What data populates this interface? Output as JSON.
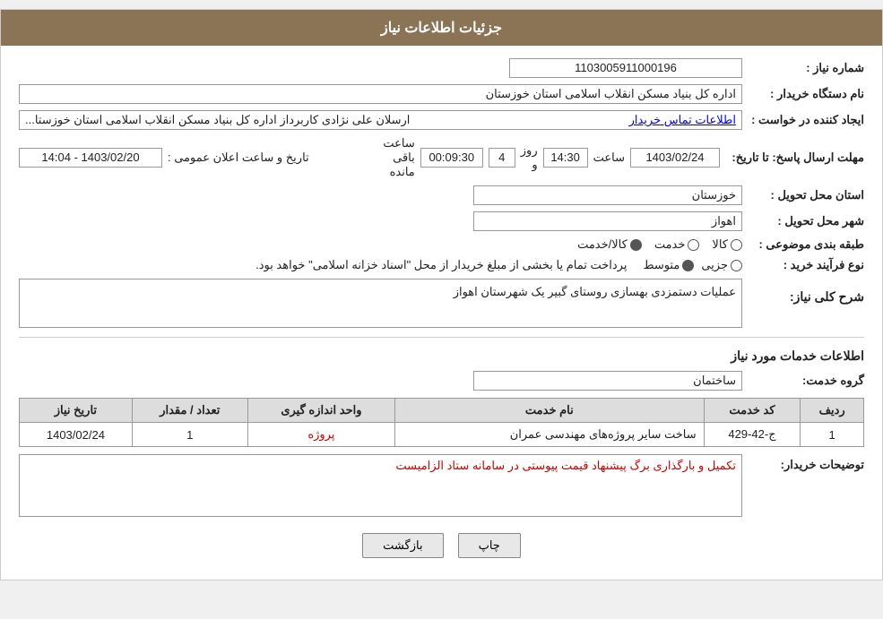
{
  "header": {
    "title": "جزئیات اطلاعات نیاز"
  },
  "fields": {
    "need_number_label": "شماره نیاز :",
    "need_number_value": "1103005911000196",
    "buyer_org_label": "نام دستگاه خریدار :",
    "buyer_org_value": "اداره کل بنیاد مسکن انقلاب اسلامی استان خوزستان",
    "creator_label": "ایجاد کننده در خواست :",
    "creator_value": "ارسلان علی نژادی کاربرداز اداره کل بنیاد مسکن انقلاب اسلامی استان خوزستا...",
    "creator_link": "اطلاعات تماس خریدار",
    "response_date_label": "مهلت ارسال پاسخ: تا تاریخ:",
    "announcement_label": "تاریخ و ساعت اعلان عمومی :",
    "announcement_value": "1403/02/20 - 14:04",
    "response_date": "1403/02/24",
    "response_time_label": "ساعت",
    "response_time": "14:30",
    "response_days_label": "روز و",
    "response_days": "4",
    "response_remaining_label": "ساعت باقی مانده",
    "response_remaining": "00:09:30",
    "province_label": "استان محل تحویل :",
    "province_value": "خوزستان",
    "city_label": "شهر محل تحویل :",
    "city_value": "اهواز",
    "category_label": "طبقه بندی موضوعی :",
    "category_goods": "کالا",
    "category_service": "خدمت",
    "category_goods_service": "کالا/خدمت",
    "category_selected": "goods_service",
    "purchase_type_label": "نوع فرآیند خرید :",
    "purchase_partial": "جزیی",
    "purchase_medium": "متوسط",
    "purchase_note": "پرداخت تمام یا بخشی از مبلغ خریدار از محل \"اسناد خزانه اسلامی\" خواهد بود.",
    "description_section": "شرح کلی نیاز:",
    "description_value": "عملیات دستمزدی بهسازی روستای گبیر یک شهرستان اهواز",
    "services_section": "اطلاعات خدمات مورد نیاز",
    "service_group_label": "گروه خدمت:",
    "service_group_value": "ساختمان",
    "table_headers": {
      "row_num": "ردیف",
      "service_code": "کد خدمت",
      "service_name": "نام خدمت",
      "unit": "واحد اندازه گیری",
      "quantity": "تعداد / مقدار",
      "need_date": "تاریخ نیاز"
    },
    "table_rows": [
      {
        "row_num": "1",
        "service_code": "ج-42-429",
        "service_name": "ساخت سایر پروژه‌های مهندسی عمران",
        "unit": "پروژه",
        "quantity": "1",
        "need_date": "1403/02/24"
      }
    ],
    "buyer_notes_label": "توضیحات خریدار:",
    "buyer_notes_value": "تکمیل و بارگذاری برگ پیشنهاد قیمت پیوستی در سامانه ستاد الزامیست",
    "btn_print": "چاپ",
    "btn_back": "بازگشت"
  }
}
